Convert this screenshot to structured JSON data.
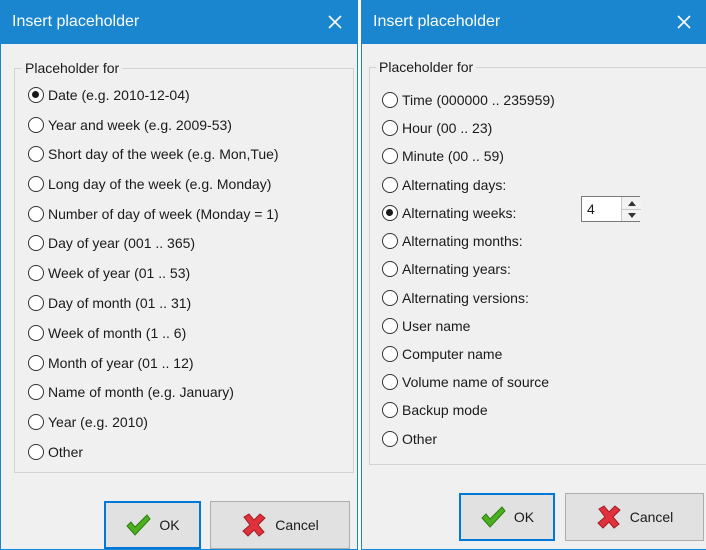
{
  "left_dialog": {
    "title": "Insert placeholder",
    "group_label": "Placeholder for",
    "options": [
      {
        "label": "Date (e.g. 2010-12-04)",
        "checked": true
      },
      {
        "label": "Year and week (e.g. 2009-53)",
        "checked": false
      },
      {
        "label": "Short day of the week (e.g. Mon,Tue)",
        "checked": false
      },
      {
        "label": "Long day of the week (e.g. Monday)",
        "checked": false
      },
      {
        "label": "Number of day of week (Monday = 1)",
        "checked": false
      },
      {
        "label": "Day of year (001 .. 365)",
        "checked": false
      },
      {
        "label": "Week of year (01 .. 53)",
        "checked": false
      },
      {
        "label": "Day of month (01 .. 31)",
        "checked": false
      },
      {
        "label": "Week of month (1 .. 6)",
        "checked": false
      },
      {
        "label": "Month of year (01 .. 12)",
        "checked": false
      },
      {
        "label": "Name of month (e.g. January)",
        "checked": false
      },
      {
        "label": "Year (e.g. 2010)",
        "checked": false
      },
      {
        "label": "Other",
        "checked": false
      }
    ],
    "ok_label": "OK",
    "cancel_label": "Cancel"
  },
  "right_dialog": {
    "title": "Insert placeholder",
    "group_label": "Placeholder for",
    "options": [
      {
        "label": "Time (000000 .. 235959)",
        "checked": false
      },
      {
        "label": "Hour (00 .. 23)",
        "checked": false
      },
      {
        "label": "Minute (00 .. 59)",
        "checked": false
      },
      {
        "label": "Alternating days:",
        "checked": false
      },
      {
        "label": "Alternating weeks:",
        "checked": true
      },
      {
        "label": "Alternating months:",
        "checked": false
      },
      {
        "label": "Alternating years:",
        "checked": false
      },
      {
        "label": "Alternating versions:",
        "checked": false
      },
      {
        "label": "User name",
        "checked": false
      },
      {
        "label": "Computer name",
        "checked": false
      },
      {
        "label": "Volume name of source",
        "checked": false
      },
      {
        "label": "Backup mode",
        "checked": false
      },
      {
        "label": "Other",
        "checked": false
      }
    ],
    "spinner_value": "4",
    "ok_label": "OK",
    "cancel_label": "Cancel"
  },
  "icons": {
    "close": "close-icon",
    "ok": "checkmark-icon",
    "cancel": "cross-icon",
    "spin_up": "arrow-up-icon",
    "spin_down": "arrow-down-icon"
  },
  "colors": {
    "titlebar": "#1a86d0",
    "dialog_bg": "#f0f0f0",
    "default_button_border": "#0078d7",
    "ok_check": "#4caf1f",
    "cancel_cross": "#e0323c"
  }
}
